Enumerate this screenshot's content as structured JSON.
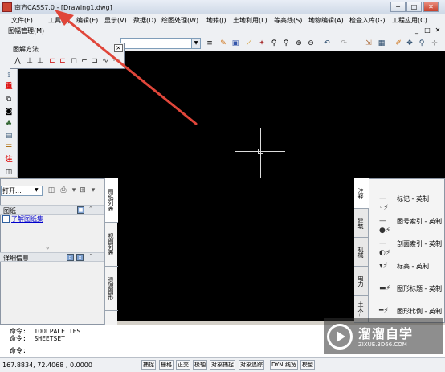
{
  "window": {
    "title": "南方CASS7.0 - [Drawing1.dwg]",
    "controls": [
      "─",
      "□",
      "✕"
    ]
  },
  "menubar": {
    "items": [
      "文件(F)",
      "工具(T)",
      "编辑(E)",
      "显示(V)",
      "数据(D)",
      "绘图处理(W)",
      "地籍(J)",
      "土地利用(L)",
      "等高线(S)",
      "地物编辑(A)",
      "检查入库(G)",
      "工程应用(C)"
    ],
    "sub_label": "图幅管理(M)",
    "mdi_controls": [
      "_",
      "□",
      "✕"
    ]
  },
  "toolbar": {
    "icons": [
      "pen-icon",
      "save-icon",
      "line-icon",
      "arc-icon",
      "zoom-realtime-icon",
      "zoom-window-icon",
      "zoom-in-icon",
      "zoom-out-icon",
      "undo-icon",
      "redo-icon",
      "stretch-icon",
      "grid-icon",
      "brush-icon",
      "pan-icon",
      "zoom-icon",
      "snap-icon"
    ]
  },
  "left_toolbar": {
    "icons": [
      "fix-icon",
      "heavy-icon",
      "copy-icon",
      "camera-icon",
      "tree-icon",
      "building-icon",
      "ruler-icon",
      "annotate-icon",
      "frame-icon"
    ],
    "labels": [
      "重",
      "注"
    ]
  },
  "float_toolbar": {
    "title": "图解方法",
    "close": "×"
  },
  "sheet_set": {
    "dropdown_value": "打开...",
    "section_sheets": "图纸",
    "sheets_link": "了解图纸集",
    "section_details": "详细信息",
    "tabs": [
      "图纸列表",
      "视图列表",
      "资源图形"
    ]
  },
  "tool_palette": {
    "tabs": [
      "注释",
      "建筑",
      "机械",
      "电力",
      "土木..."
    ],
    "tools": [
      "标记 - 英制",
      "图号索引 - 英制",
      "剖面索引 - 英制",
      "标高 - 英制",
      "图形标题 - 英制",
      "图形比例 - 英制"
    ]
  },
  "command": {
    "lines": [
      "命令:  TOOLPALETTES",
      "命令:  SHEETSET",
      "命令:"
    ]
  },
  "status": {
    "coords": "167.8834,  72.4068 ,  0.0000",
    "buttons": [
      "捕捉",
      "栅格",
      "正交",
      "极轴",
      "对象捕捉",
      "对象追踪",
      "DYN",
      "线宽",
      "模型"
    ]
  },
  "watermark": {
    "title": "溜溜自学",
    "subtitle": "ZIXUE.3D66.COM"
  },
  "colors": {
    "canvas": "#000000",
    "annotation_arrow": "#e0463a"
  }
}
